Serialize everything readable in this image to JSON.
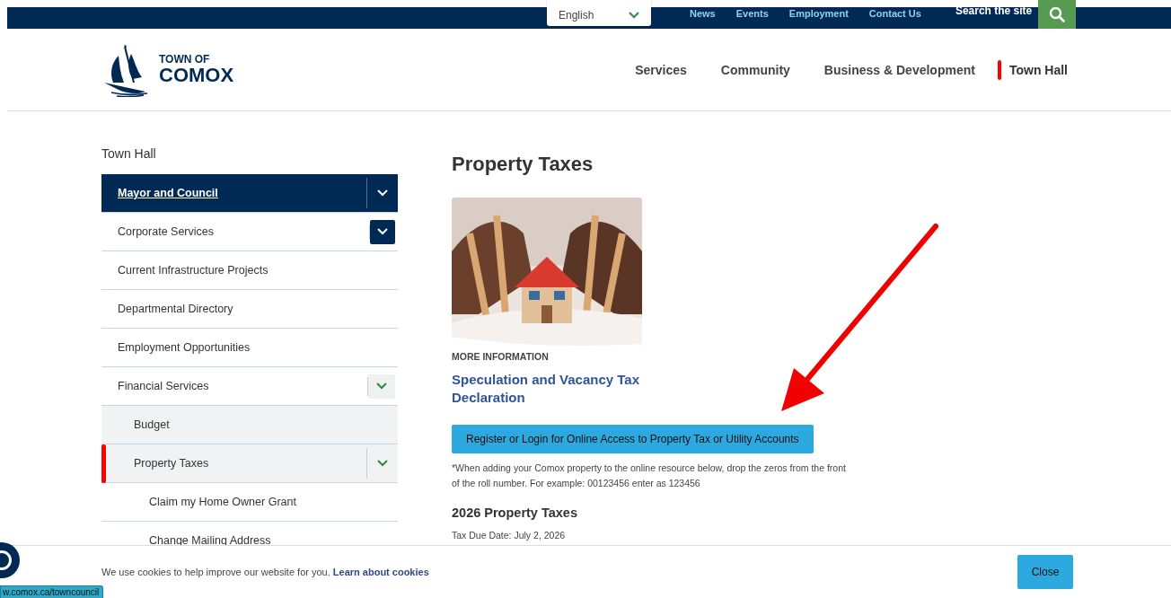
{
  "top_bar": {
    "language": {
      "value": "English"
    },
    "links": [
      {
        "label": "News"
      },
      {
        "label": "Events"
      },
      {
        "label": "Employment"
      },
      {
        "label": "Contact Us"
      }
    ],
    "search": {
      "placeholder": "Search the site"
    }
  },
  "logo": {
    "line_1": "TOWN OF",
    "line_2": "COMOX"
  },
  "main_nav": [
    {
      "label": "Services",
      "selected": false
    },
    {
      "label": "Community",
      "selected": false
    },
    {
      "label": "Business & Development",
      "selected": false
    },
    {
      "label": "Town Hall",
      "selected": true
    }
  ],
  "sidebar": {
    "title": "Town Hall",
    "items": [
      {
        "label": "Mayor and Council",
        "selected": true,
        "current": false,
        "expanded": false,
        "hovered": false
      },
      {
        "label": "Corporate Services",
        "selected": false,
        "current": false,
        "expanded": false,
        "hovered": true
      },
      {
        "label": "Current Infrastructure Projects",
        "selected": false,
        "current": false
      },
      {
        "label": "Departmental Directory",
        "selected": false,
        "current": false
      },
      {
        "label": "Employment Opportunities",
        "selected": false,
        "current": false
      },
      {
        "label": "Financial Services",
        "selected": false,
        "current": false,
        "expanded": true,
        "hovered": false,
        "children": [
          {
            "label": "Budget",
            "selected": false,
            "current": false
          },
          {
            "label": "Property Taxes",
            "selected": false,
            "current": true,
            "expanded": true,
            "hovered": false,
            "children": [
              {
                "label": "Claim my Home Owner Grant",
                "selected": false,
                "current": false
              },
              {
                "label": "Change Mailing Address",
                "selected": false,
                "current": false
              }
            ]
          }
        ]
      }
    ]
  },
  "content": {
    "title": "Property Taxes",
    "card": {
      "kind": "picture",
      "eyebrow": "MORE INFORMATION",
      "link": "Speculation and Vacancy Tax Declaration"
    },
    "button": "Register or Login for Online Access to Property Tax or Utility Accounts",
    "note": "*When adding your Comox property to the online resource below, drop the zeros from the front of the roll number. For example: 00123456 enter as 123456",
    "section_title": "2026 Property Taxes",
    "due_date": "Tax Due Date: July 2, 2026"
  },
  "cookie_banner": {
    "text": "We use cookies to help improve our website for you.",
    "link": "Learn about cookies",
    "button": "Close"
  },
  "status_url": "w.comox.ca/towncouncil"
}
